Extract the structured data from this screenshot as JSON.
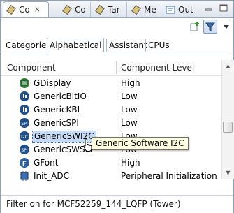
{
  "view_tabs": [
    {
      "label": "Co",
      "icon": "component-icon",
      "active": true,
      "close": "×"
    },
    {
      "label": "Co",
      "icon": "component-icon"
    },
    {
      "label": "Tar",
      "icon": "target-icon"
    },
    {
      "label": "Me",
      "icon": "memory-icon"
    },
    {
      "label": "Out",
      "icon": "outline-icon"
    }
  ],
  "toolbar": {
    "add_icon": "add-icon",
    "filter_icon": "filter-icon",
    "menu_icon": "view-menu-icon"
  },
  "inner_tabs": [
    "Categories",
    "Alphabetical",
    "Assistant",
    "CPUs"
  ],
  "table": {
    "headers": {
      "component": "Component",
      "level": "Component Level"
    },
    "rows": [
      {
        "name": "GDisplay",
        "level": "High",
        "icon": "green-component-icon"
      },
      {
        "name": "GenericBitIO",
        "level": "Low",
        "icon": "io-component-icon"
      },
      {
        "name": "GenericKBI",
        "level": "Low",
        "icon": "io-component-icon"
      },
      {
        "name": "GenericSPI",
        "level": "Low",
        "icon": "spi-component-icon"
      },
      {
        "name": "GenericSWI2C",
        "level": "Low",
        "icon": "i2c-component-icon",
        "selected": true
      },
      {
        "name": "GenericSWSPI",
        "level": "Low",
        "icon": "spi-component-icon"
      },
      {
        "name": "GFont",
        "level": "High",
        "icon": "font-component-icon"
      },
      {
        "name": "Init_ADC",
        "level": "Peripheral Initialization",
        "icon": "adc-component-icon"
      }
    ]
  },
  "tooltip": "Generic Software I2C",
  "status": "Filter on for MCF52259_144_LQFP (Tower)",
  "colors": {
    "selection": "#c6dcf7",
    "tooltip_bg": "#ffffe1",
    "icon_blue": "#2a5d9a"
  }
}
